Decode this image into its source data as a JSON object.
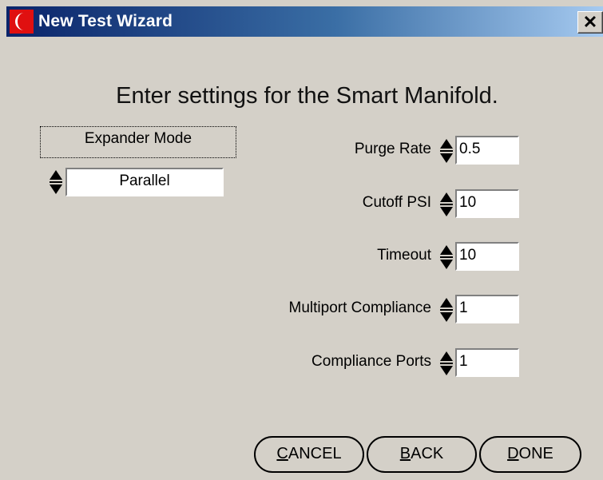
{
  "window": {
    "title": "New Test Wizard",
    "close_glyph": "✕"
  },
  "heading": "Enter settings for the Smart Manifold.",
  "expander": {
    "label": "Expander Mode",
    "value": "Parallel"
  },
  "settings": [
    {
      "label": "Purge Rate",
      "value": "0.5"
    },
    {
      "label": "Cutoff PSI",
      "value": "10"
    },
    {
      "label": "Timeout",
      "value": "10"
    },
    {
      "label": "Multiport Compliance",
      "value": "1"
    },
    {
      "label": "Compliance Ports",
      "value": "1"
    }
  ],
  "buttons": {
    "cancel": {
      "first": "C",
      "rest": "ANCEL"
    },
    "back": {
      "first": "B",
      "rest": "ACK"
    },
    "done": {
      "first": "D",
      "rest": "ONE"
    }
  },
  "colors": {
    "window_bg": "#d4d0c8",
    "title_start": "#0a246a",
    "title_end": "#a6caf0",
    "icon_red": "#e01010"
  }
}
